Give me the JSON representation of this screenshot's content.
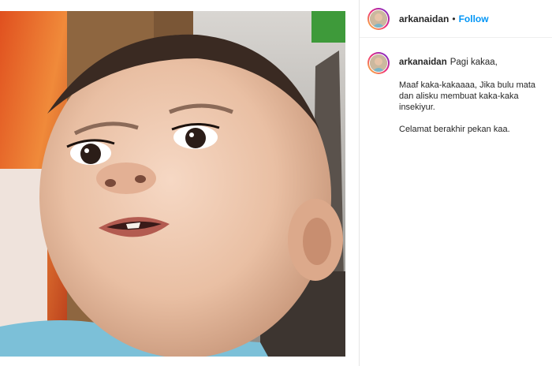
{
  "post": {
    "username": "arkanaidan",
    "separator": "•",
    "follow_label": "Follow"
  },
  "caption": {
    "username": "arkanaidan",
    "first_line": "Pagi kakaa,",
    "paragraph_1": "Maaf kaka-kakaaaa, Jika bulu mata dan alisku membuat kaka-kaka insekiyur.",
    "paragraph_2": "Celamat berakhir pekan kaa."
  },
  "icons": {
    "avatar_header": "profile-avatar",
    "avatar_caption": "profile-avatar"
  },
  "colors": {
    "follow_blue": "#0095f6",
    "text": "#262626",
    "story_ring": "#ee2a7b"
  }
}
